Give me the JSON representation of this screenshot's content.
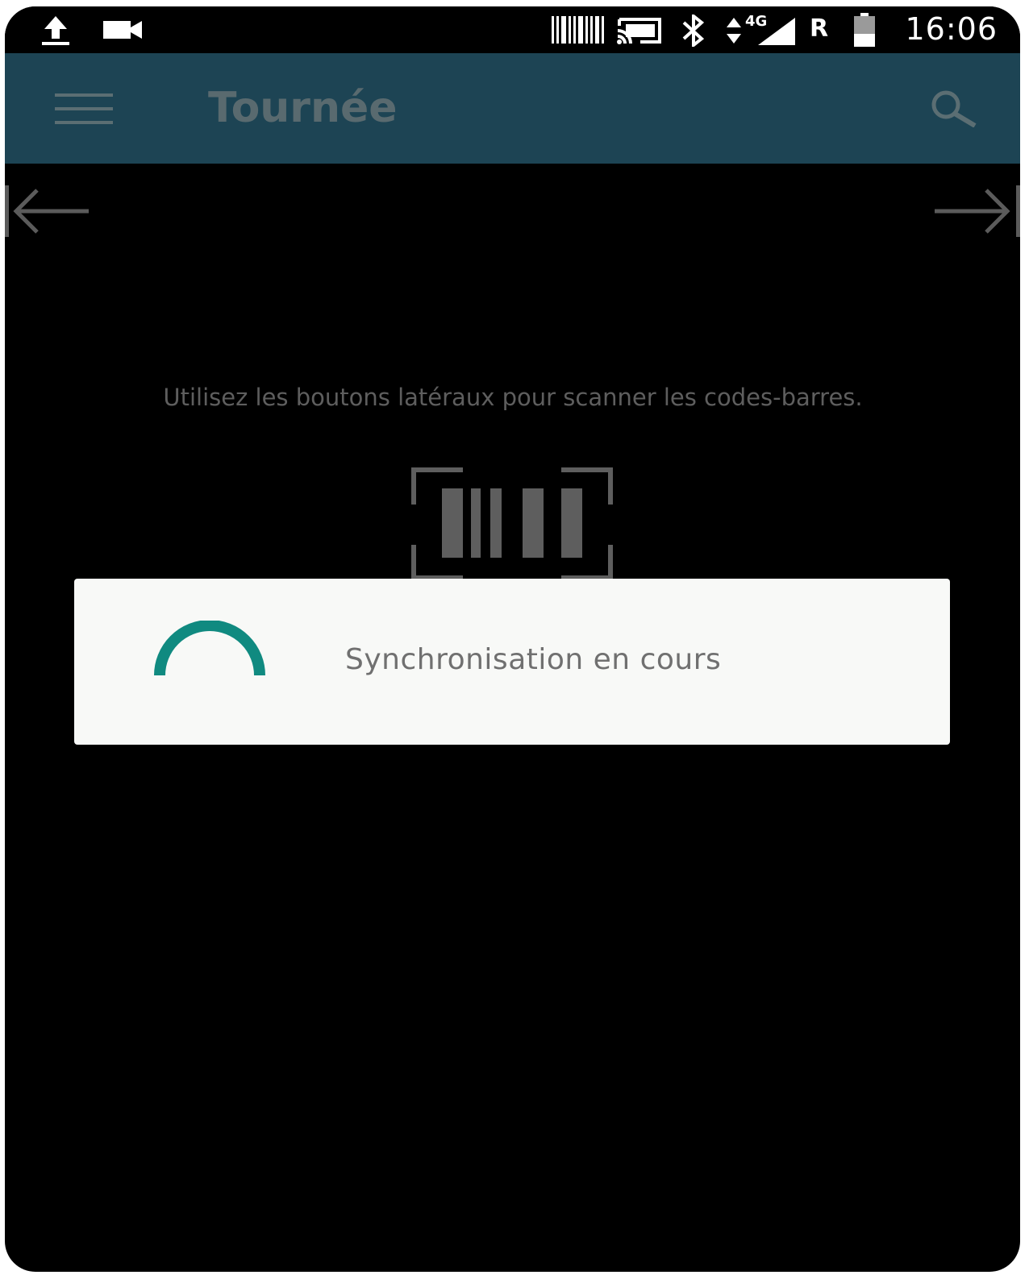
{
  "status_bar": {
    "time": "16:06",
    "network": "4G",
    "roaming": "R",
    "icons": [
      "upload-icon",
      "video-camera-icon",
      "barcode-scanner-icon",
      "cast-icon",
      "bluetooth-icon",
      "data-arrows-icon",
      "signal-icon",
      "battery-icon"
    ]
  },
  "app_bar": {
    "title": "Tournée",
    "menu_icon": "menu-icon",
    "search_icon": "search-icon",
    "background_color": "#1d4454"
  },
  "navigation": {
    "prev_icon": "arrow-to-left-icon",
    "next_icon": "arrow-to-right-icon"
  },
  "main": {
    "instruction": "Utilisez les boutons latéraux pour scanner les codes-barres.",
    "illustration_icon": "barcode-icon"
  },
  "dialog": {
    "message": "Synchronisation en cours",
    "spinner_color": "#108a80"
  }
}
